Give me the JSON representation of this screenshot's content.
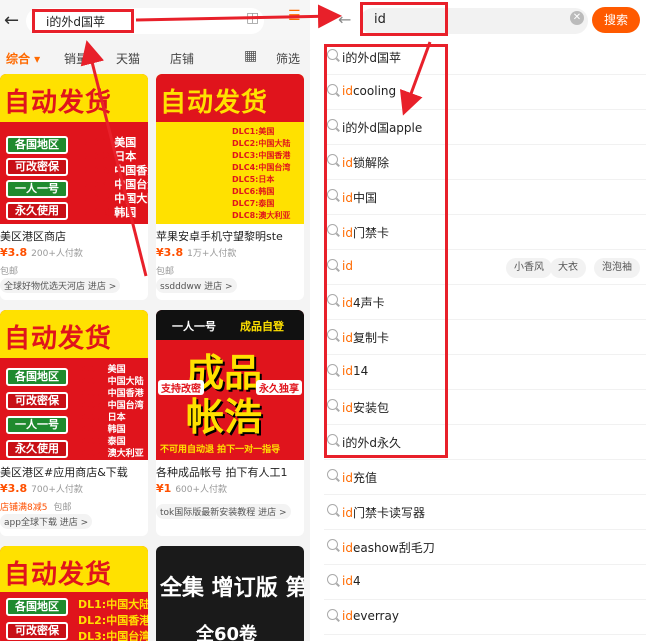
{
  "left": {
    "query": "i的外d国苹",
    "filter_tabs": [
      {
        "label": "综合 ▾",
        "active": true
      },
      {
        "label": "销量",
        "active": false
      },
      {
        "label": "天猫",
        "active": false
      },
      {
        "label": "店铺",
        "active": false
      },
      {
        "label": "筛选",
        "active": false
      }
    ],
    "products": [
      {
        "img": {
          "headline": "自动发货",
          "tags": [
            "各国地区",
            "可改密保",
            "一人一号",
            "永久使用"
          ],
          "dlc": [
            [
              "DLC1:",
              "美国"
            ],
            [
              "DLC2:",
              "日本"
            ],
            [
              "DLC3:",
              "中国香港"
            ],
            [
              "DLC4:",
              "中国台湾"
            ],
            [
              "DLC5:",
              "中国大陆"
            ],
            [
              "DLC6:",
              "韩国"
            ]
          ]
        },
        "title": "美区港区商店",
        "price": "¥3.8",
        "sold": "200+人付款",
        "ship": "包邮",
        "shop": "全球好物优选天河店 进店 >"
      },
      {
        "img": {
          "headline": "自动发货",
          "dlc": [
            "DLC1:美国",
            "DLC2:中国大陆",
            "DLC3:中国香港",
            "DLC4:中国台湾",
            "DLC5:日本",
            "DLC6:韩国",
            "DLC7:泰国",
            "DLC8:澳大利亚"
          ]
        },
        "title": "苹果安卓手机守望黎明ste",
        "price": "¥3.8",
        "sold": "1万+人付款",
        "ship": "包邮",
        "shop": "ssdddww 进店 >"
      },
      {
        "img": {
          "headline": "自动发货",
          "tags": [
            "各国地区",
            "可改密保",
            "一人一号",
            "永久使用"
          ],
          "dlc": [
            [
              "DLC1:",
              "美国"
            ],
            [
              "DLC2:",
              "中国大陆"
            ],
            [
              "DLC3:",
              "中国香港"
            ],
            [
              "DLC4:",
              "中国台湾"
            ],
            [
              "DLC5:",
              "日本"
            ],
            [
              "DLC6:",
              "韩国"
            ],
            [
              "DLC7:",
              "泰国"
            ],
            [
              "DLC8:",
              "澳大利亚"
            ]
          ]
        },
        "title": "美区港区#应用商店&下载",
        "price": "¥3.8",
        "sold": "700+人付款",
        "promo": "店铺满8减5",
        "ship": "包邮",
        "shop": "app全球下载 进店 >"
      },
      {
        "img": {
          "top": "一人一号",
          "top2": "成品自登",
          "big1": "成品",
          "big2": "帐浩",
          "side1": "支持改密",
          "side2": "永久独享",
          "bottom": "不可用自动退 拍下一对一指导"
        },
        "title": "各种成品帐号 拍下有人工1",
        "price": "¥1",
        "sold": "600+人付款",
        "ship": "",
        "shop": "tok国际版最新安装教程 进店 >"
      },
      {
        "img": {
          "headline": "自动发货",
          "tags": [
            "各国地区",
            "可改密保"
          ],
          "dlc": [
            [
              "DL1:",
              "中国大陆"
            ],
            [
              "DL2:",
              "中国香港"
            ],
            [
              "DL3:",
              "中国台湾"
            ]
          ]
        }
      },
      {
        "img": {
          "line1": "全集 增订版 第",
          "line2": "全60卷"
        }
      }
    ]
  },
  "right": {
    "query": "id",
    "search_label": "搜索",
    "suggestions": [
      {
        "hl": "",
        "rest": "i的外d国苹"
      },
      {
        "hl": "id",
        "rest": "cooling"
      },
      {
        "hl": "",
        "rest": "i的外d国apple"
      },
      {
        "hl": "id",
        "rest": "锁解除"
      },
      {
        "hl": "id",
        "rest": "中国"
      },
      {
        "hl": "id",
        "rest": "门禁卡"
      },
      {
        "hl": "id",
        "rest": "",
        "chips": [
          "小香风",
          "大衣",
          "泡泡袖"
        ]
      },
      {
        "hl": "id",
        "rest": "4声卡"
      },
      {
        "hl": "id",
        "rest": "复制卡"
      },
      {
        "hl": "id",
        "rest": "14"
      },
      {
        "hl": "id",
        "rest": "安装包"
      },
      {
        "hl": "",
        "rest": "i的外d永久"
      },
      {
        "hl": "id",
        "rest": "充值"
      },
      {
        "hl": "id",
        "rest": "门禁卡读写器"
      },
      {
        "hl": "id",
        "rest": "eashow刮毛刀"
      },
      {
        "hl": "id",
        "rest": "4"
      },
      {
        "hl": "id",
        "rest": "everray"
      }
    ]
  },
  "colors": {
    "accent": "#ff6a00",
    "annotation": "#e8202a",
    "price": "#ff5000"
  }
}
